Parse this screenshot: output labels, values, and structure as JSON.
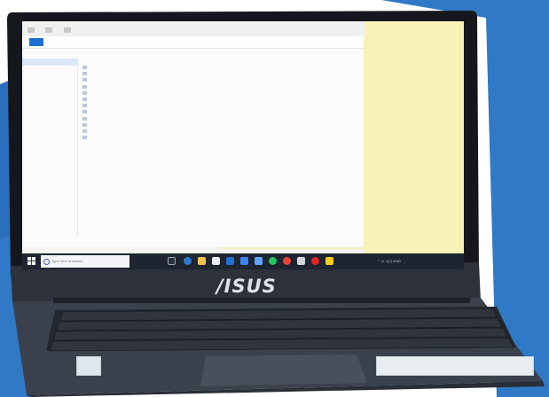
{
  "scene": {
    "description_colors": {
      "background_blue": "#2f79c6",
      "laptop_body": "#3a3f4a",
      "bezel": "#15171d",
      "screen_explorer": "#fbfbfb",
      "sticky_note": "#f8f1b8",
      "taskbar": "#1e2430",
      "accent": "#1e6fd0"
    }
  },
  "explorer": {
    "nav_items_count": 9,
    "rows_count": 12
  },
  "taskbar": {
    "search_placeholder": "Type here to search"
  },
  "brand": {
    "logo_text": "/ISUS"
  }
}
